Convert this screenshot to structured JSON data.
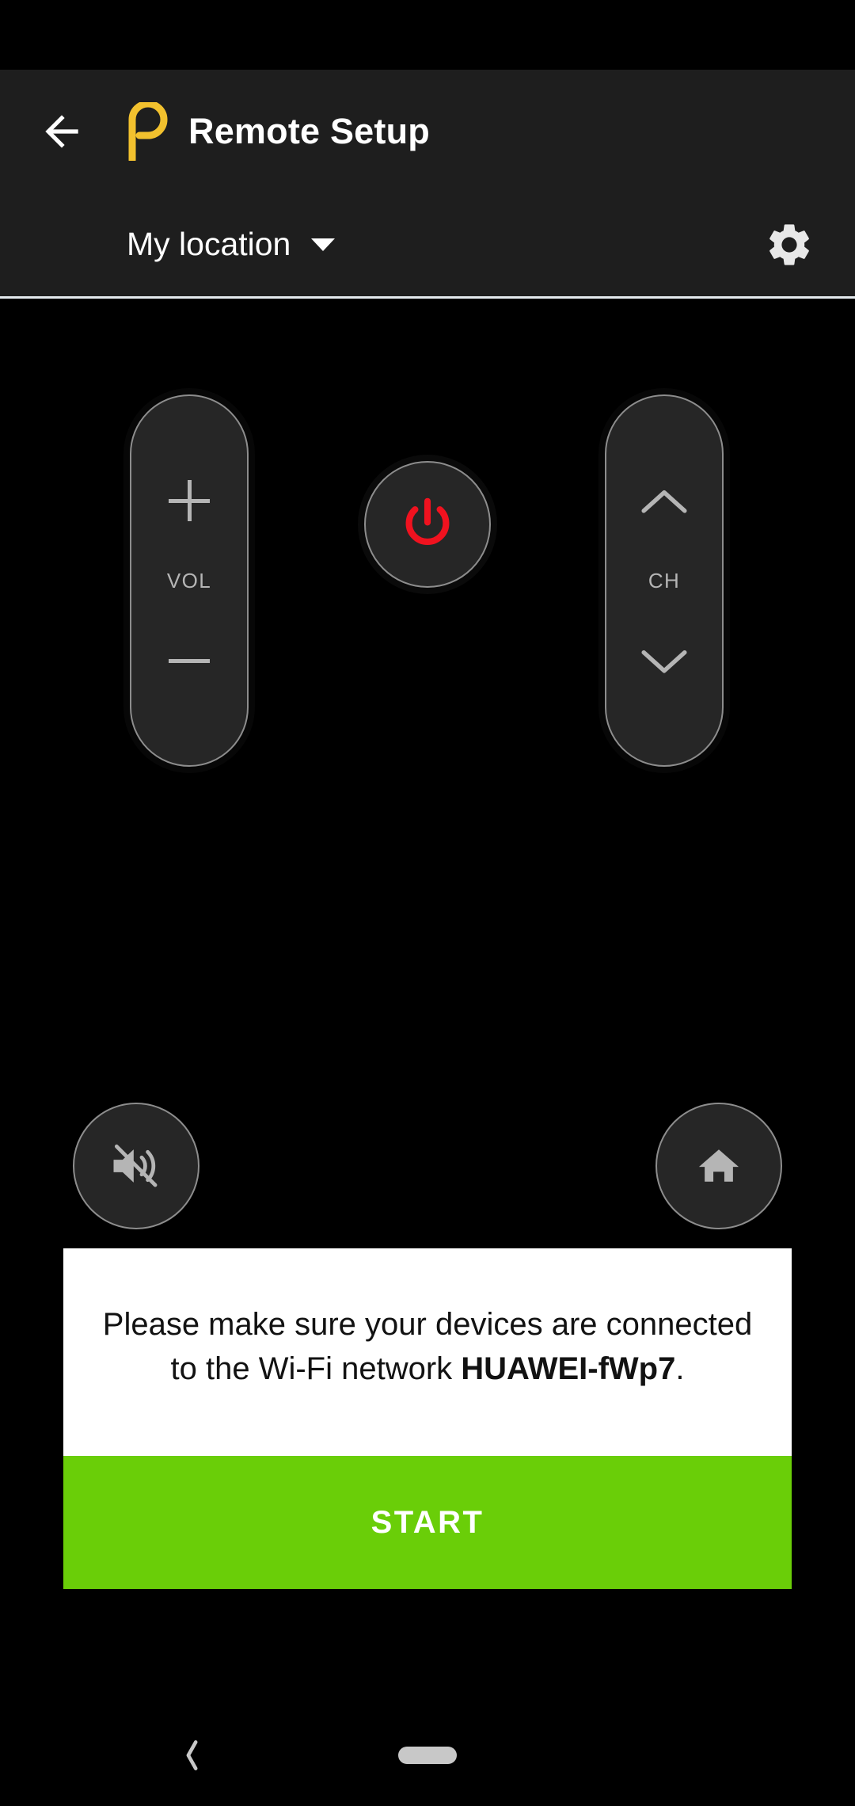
{
  "app": {
    "title": "Remote Setup",
    "brand_logo_icon": "peel-p-logo-icon",
    "brand_color": "#F2C12E",
    "back_icon": "arrow-left-icon"
  },
  "location_bar": {
    "selected_location": "My location",
    "caret_icon": "caret-down-icon",
    "settings_icon": "gear-icon"
  },
  "remote": {
    "volume": {
      "label": "VOL",
      "up_icon": "plus-icon",
      "down_icon": "minus-icon"
    },
    "channel": {
      "label": "CH",
      "up_icon": "chevron-up-icon",
      "down_icon": "chevron-down-icon"
    },
    "power": {
      "icon": "power-icon",
      "color": "#F0121F"
    },
    "mute": {
      "icon": "volume-mute-icon"
    },
    "home": {
      "icon": "home-icon"
    }
  },
  "setup_card": {
    "message_part1": "Please make sure your devices are connected to the Wi-Fi network ",
    "network_name": "HUAWEI-fWp7",
    "message_part2": ".",
    "start_label": "START",
    "start_color": "#6ACE08"
  },
  "nav_bar": {
    "back_icon": "chevron-left-icon",
    "home_indicator": "home-pill-indicator"
  }
}
